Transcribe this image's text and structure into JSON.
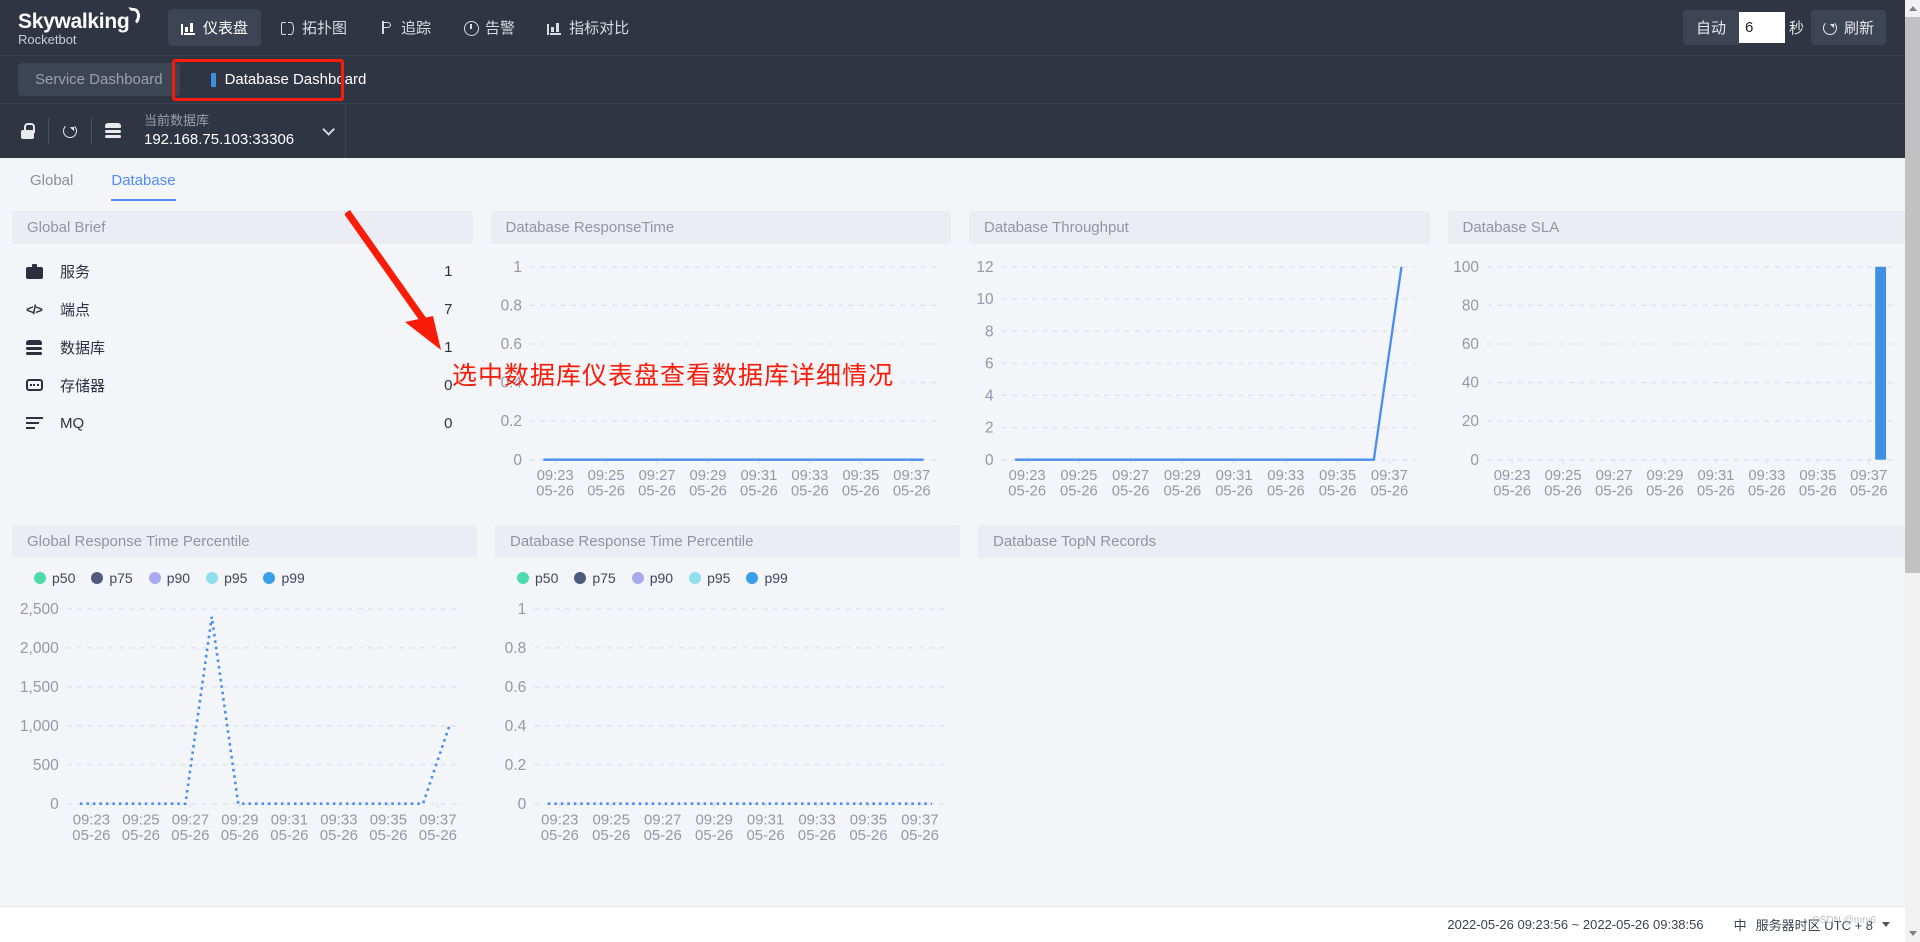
{
  "header": {
    "logo_main": "Skywalking",
    "logo_sub": "Rocketbot",
    "nav": [
      {
        "label": "仪表盘",
        "icon": "chart-icon",
        "active": true
      },
      {
        "label": "拓扑图",
        "icon": "topology-icon",
        "active": false
      },
      {
        "label": "追踪",
        "icon": "trace-icon",
        "active": false
      },
      {
        "label": "告警",
        "icon": "alarm-icon",
        "active": false
      },
      {
        "label": "指标对比",
        "icon": "chart-icon",
        "active": false
      }
    ],
    "auto_label": "自动",
    "interval_value": "6",
    "seconds_label": "秒",
    "refresh_label": "刷新"
  },
  "dashboards": {
    "service": "Service Dashboard",
    "database": "Database Dashboard"
  },
  "toolbar": {
    "lock_icon": "lock-icon",
    "refresh_icon": "refresh-icon",
    "db_icon": "database-icon",
    "current_db_label": "当前数据库",
    "current_db_value": "192.168.75.103:33306"
  },
  "subtabs": [
    {
      "label": "Global",
      "active": false
    },
    {
      "label": "Database",
      "active": true
    }
  ],
  "annotation": {
    "text": "选中数据库仪表盘查看数据库详细情况",
    "color": "#f91c08"
  },
  "panels": {
    "global_brief": {
      "title": "Global Brief",
      "items": [
        {
          "icon": "service-icon",
          "label": "服务",
          "value": "1"
        },
        {
          "icon": "endpoint-icon",
          "label": "端点",
          "value": "7"
        },
        {
          "icon": "database-icon",
          "label": "数据库",
          "value": "1"
        },
        {
          "icon": "cache-icon",
          "label": "存储器",
          "value": "0"
        },
        {
          "icon": "mq-icon",
          "label": "MQ",
          "value": "0"
        }
      ]
    },
    "db_response_time": {
      "title": "Database ResponseTime"
    },
    "db_throughput": {
      "title": "Database Throughput"
    },
    "db_sla": {
      "title": "Database SLA"
    },
    "global_percentile": {
      "title": "Global Response Time Percentile"
    },
    "db_percentile": {
      "title": "Database Response Time Percentile"
    },
    "db_topn": {
      "title": "Database TopN Records"
    }
  },
  "legend": [
    {
      "label": "p50",
      "color": "#4ddbac"
    },
    {
      "label": "p75",
      "color": "#4f5a7f"
    },
    {
      "label": "p90",
      "color": "#a9a9ee"
    },
    {
      "label": "p95",
      "color": "#8fdfee"
    },
    {
      "label": "p99",
      "color": "#3a9fe8"
    }
  ],
  "footer": {
    "time_range": "2022-05-26 09:23:56 ~ 2022-05-26 09:38:56",
    "lang": "中",
    "timezone": "服务器时区 UTC + 8",
    "watermark": "CSDN @mry6"
  },
  "chart_data": [
    {
      "id": "db_response_time",
      "type": "line",
      "title": "Database ResponseTime",
      "x": [
        "09:23",
        "09:24",
        "09:25",
        "09:26",
        "09:27",
        "09:28",
        "09:29",
        "09:30",
        "09:31",
        "09:32",
        "09:33",
        "09:34",
        "09:35",
        "09:36",
        "09:37"
      ],
      "xtick_labels": [
        "09:23",
        "09:25",
        "09:27",
        "09:29",
        "09:31",
        "09:33",
        "09:35",
        "09:37"
      ],
      "xtick_dates": [
        "05-26",
        "05-26",
        "05-26",
        "05-26",
        "05-26",
        "05-26",
        "05-26",
        "05-26"
      ],
      "ytick_labels": [
        "0",
        "0.2",
        "0.4",
        "0.6",
        "0.8",
        "1"
      ],
      "ylim": [
        0,
        1
      ],
      "values": [
        0,
        0,
        0,
        0,
        0,
        0,
        0,
        0,
        0,
        0,
        0,
        0,
        0,
        0,
        0
      ],
      "color": "#4a8ff0",
      "grid": true,
      "legend": "none"
    },
    {
      "id": "db_throughput",
      "type": "line",
      "title": "Database Throughput",
      "x": [
        "09:23",
        "09:24",
        "09:25",
        "09:26",
        "09:27",
        "09:28",
        "09:29",
        "09:30",
        "09:31",
        "09:32",
        "09:33",
        "09:34",
        "09:35",
        "09:36",
        "09:37"
      ],
      "xtick_labels": [
        "09:23",
        "09:25",
        "09:27",
        "09:29",
        "09:31",
        "09:33",
        "09:35",
        "09:37"
      ],
      "xtick_dates": [
        "05-26",
        "05-26",
        "05-26",
        "05-26",
        "05-26",
        "05-26",
        "05-26",
        "05-26"
      ],
      "ytick_labels": [
        "0",
        "2",
        "4",
        "6",
        "8",
        "10",
        "12"
      ],
      "ylim": [
        0,
        12
      ],
      "values": [
        0,
        0,
        0,
        0,
        0,
        0,
        0,
        0,
        0,
        0,
        0,
        0,
        0,
        0,
        12
      ],
      "color": "#4a8ff0",
      "grid": true,
      "legend": "none"
    },
    {
      "id": "db_sla",
      "type": "bar",
      "title": "Database SLA",
      "categories": [
        "09:23",
        "09:24",
        "09:25",
        "09:26",
        "09:27",
        "09:28",
        "09:29",
        "09:30",
        "09:31",
        "09:32",
        "09:33",
        "09:34",
        "09:35",
        "09:36",
        "09:37"
      ],
      "xtick_labels": [
        "09:23",
        "09:25",
        "09:27",
        "09:29",
        "09:31",
        "09:33",
        "09:35",
        "09:37"
      ],
      "xtick_dates": [
        "05-26",
        "05-26",
        "05-26",
        "05-26",
        "05-26",
        "05-26",
        "05-26",
        "05-26"
      ],
      "ytick_labels": [
        "0",
        "20",
        "40",
        "60",
        "80",
        "100"
      ],
      "ylim": [
        0,
        100
      ],
      "values": [
        0,
        0,
        0,
        0,
        0,
        0,
        0,
        0,
        0,
        0,
        0,
        0,
        0,
        0,
        100
      ],
      "color": "#3f90e0",
      "grid": true,
      "legend": "none"
    },
    {
      "id": "global_percentile",
      "type": "line",
      "title": "Global Response Time Percentile",
      "x": [
        "09:23",
        "09:24",
        "09:25",
        "09:26",
        "09:27",
        "09:28",
        "09:29",
        "09:30",
        "09:31",
        "09:32",
        "09:33",
        "09:34",
        "09:35",
        "09:36",
        "09:37"
      ],
      "xtick_labels": [
        "09:23",
        "09:25",
        "09:27",
        "09:29",
        "09:31",
        "09:33",
        "09:35",
        "09:37"
      ],
      "xtick_dates": [
        "05-26",
        "05-26",
        "05-26",
        "05-26",
        "05-26",
        "05-26",
        "05-26",
        "05-26"
      ],
      "ytick_labels": [
        "0",
        "500",
        "1,000",
        "1,500",
        "2,000",
        "2,500"
      ],
      "ylim": [
        0,
        2500
      ],
      "series": [
        {
          "name": "p99",
          "color": "#4a8ff0",
          "values": [
            0,
            0,
            0,
            0,
            0,
            2400,
            0,
            0,
            0,
            0,
            0,
            0,
            0,
            0,
            1000
          ]
        }
      ],
      "legend_entries": [
        "p50",
        "p75",
        "p90",
        "p95",
        "p99"
      ],
      "grid": true
    },
    {
      "id": "db_percentile",
      "type": "line",
      "title": "Database Response Time Percentile",
      "x": [
        "09:23",
        "09:24",
        "09:25",
        "09:26",
        "09:27",
        "09:28",
        "09:29",
        "09:30",
        "09:31",
        "09:32",
        "09:33",
        "09:34",
        "09:35",
        "09:36",
        "09:37"
      ],
      "xtick_labels": [
        "09:23",
        "09:25",
        "09:27",
        "09:29",
        "09:31",
        "09:33",
        "09:35",
        "09:37"
      ],
      "xtick_dates": [
        "05-26",
        "05-26",
        "05-26",
        "05-26",
        "05-26",
        "05-26",
        "05-26",
        "05-26"
      ],
      "ytick_labels": [
        "0",
        "0.2",
        "0.4",
        "0.6",
        "0.8",
        "1"
      ],
      "ylim": [
        0,
        1
      ],
      "series": [
        {
          "name": "p99",
          "color": "#4a8ff0",
          "values": [
            0,
            0,
            0,
            0,
            0,
            0,
            0,
            0,
            0,
            0,
            0,
            0,
            0,
            0,
            0
          ]
        }
      ],
      "legend_entries": [
        "p50",
        "p75",
        "p90",
        "p95",
        "p99"
      ],
      "grid": true
    }
  ]
}
